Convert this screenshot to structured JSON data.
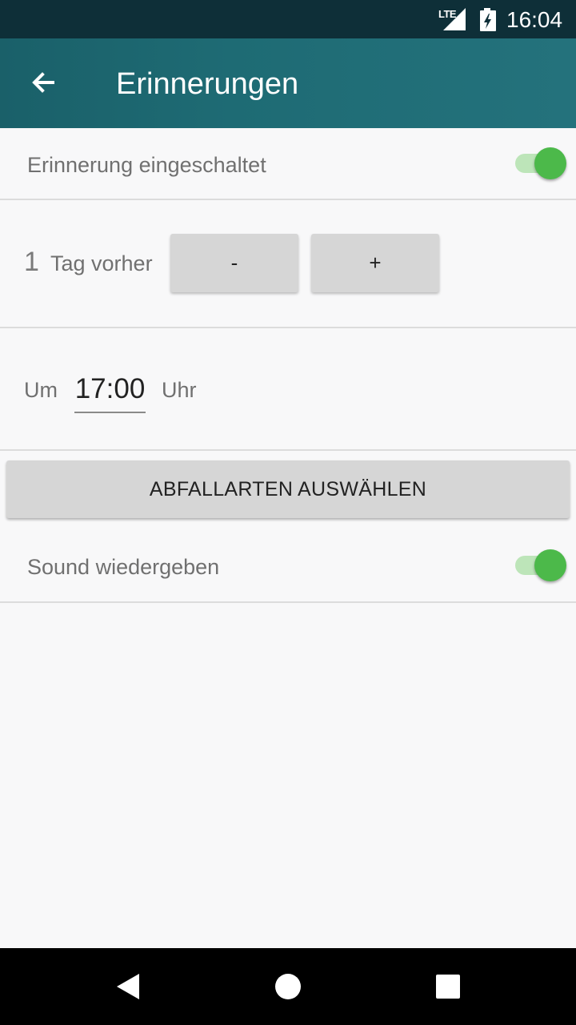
{
  "status_bar": {
    "network": "LTE",
    "time": "16:04",
    "icons": [
      "signal-icon",
      "battery-charging-icon"
    ]
  },
  "app_bar": {
    "title": "Erinnerungen",
    "back_icon": "arrow-back-icon"
  },
  "reminder": {
    "label": "Erinnerung eingeschaltet",
    "enabled": true
  },
  "days_before": {
    "count": "1",
    "label": "Tag vorher",
    "minus_label": "-",
    "plus_label": "+"
  },
  "time": {
    "prefix": "Um",
    "value": "17:00",
    "suffix": "Uhr"
  },
  "waste_types_button": {
    "label": "ABFALLARTEN AUSWÄHLEN"
  },
  "sound": {
    "label": "Sound wiedergeben",
    "enabled": true
  },
  "colors": {
    "app_bar": "#1e6b74",
    "status_bar": "#0e2f38",
    "switch_on": "#4cb94a",
    "background": "#f8f8f9"
  },
  "nav_bar": {
    "icons": [
      "back-triangle-icon",
      "home-circle-icon",
      "recents-square-icon"
    ]
  }
}
